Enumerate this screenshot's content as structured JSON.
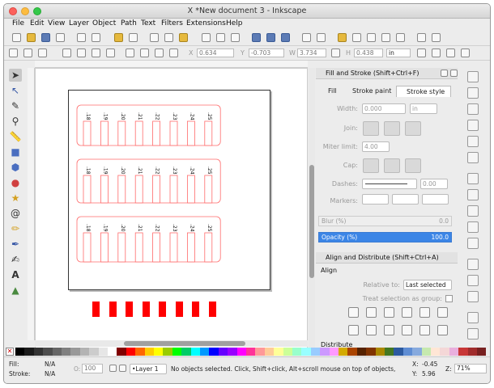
{
  "window": {
    "title": "*New document 3 - Inkscape",
    "x_glyph": "X"
  },
  "menu": [
    "File",
    "Edit",
    "View",
    "Layer",
    "Object",
    "Path",
    "Text",
    "Filters",
    "Extensions",
    "Help"
  ],
  "controls": {
    "x_label": "X",
    "x_value": "0.634",
    "y_label": "Y",
    "y_value": "-0.703",
    "w_label": "W",
    "w_value": "3.734",
    "h_label": "H",
    "h_value": "0.438",
    "unit": "in"
  },
  "design": {
    "columns": [
      ".18",
      ".19",
      ".20",
      ".21",
      ".22",
      ".23",
      ".24",
      ".25"
    ],
    "stroke_color": "#ff6b6b",
    "block_color": "#ff0000",
    "block_count": 8
  },
  "fill_stroke": {
    "header": "Fill and Stroke (Shift+Ctrl+F)",
    "tabs": [
      "Fill",
      "Stroke paint",
      "Stroke style"
    ],
    "width_label": "Width:",
    "width_value": "0.000",
    "width_unit": "in",
    "join_label": "Join:",
    "miter_label": "Miter limit:",
    "miter_value": "4.00",
    "cap_label": "Cap:",
    "dashes_label": "Dashes:",
    "dashes_value": "0.00",
    "markers_label": "Markers:",
    "blur_label": "Blur (%)",
    "blur_value": "0.0",
    "opacity_label": "Opacity (%)",
    "opacity_value": "100.0"
  },
  "align": {
    "header": "Align and Distribute (Shift+Ctrl+A)",
    "align_title": "Align",
    "relative_label": "Relative to:",
    "relative_value": "Last selected",
    "treat_label": "Treat selection as group:",
    "distribute_title": "Distribute"
  },
  "status": {
    "fill_label": "Fill:",
    "fill_value": "N/A",
    "stroke_label": "Stroke:",
    "stroke_value": "N/A",
    "opacity_label": "O:",
    "opacity_value": "100",
    "layer": "•Layer 1",
    "message": "No objects selected. Click, Shift+click, Alt+scroll mouse on top of objects,",
    "x_label": "X:",
    "x_value": "-0.45",
    "y_label": "Y:",
    "y_value": "5.96",
    "z_label": "Z:",
    "zoom": "71%"
  }
}
